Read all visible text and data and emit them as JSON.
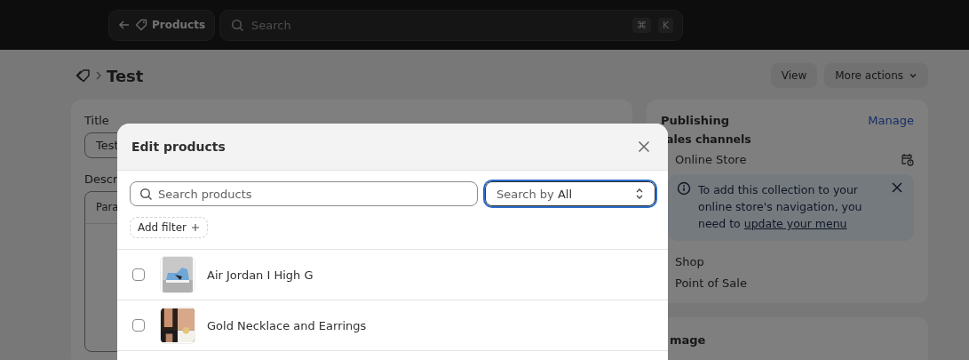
{
  "topbar": {
    "back_label": "Products",
    "search": {
      "placeholder": "Search",
      "shortcut": [
        "⌘",
        "K"
      ]
    }
  },
  "page": {
    "title": "Test",
    "actions": [
      "View",
      "More actions"
    ]
  },
  "main_card": {
    "title_label": "Title",
    "title_value": "Test",
    "description_label": "Descr",
    "editor_toolbar": "Para"
  },
  "publishing": {
    "title": "Publishing",
    "manage": "Manage",
    "channels_heading": "ales channels",
    "channels": [
      {
        "name": "Online Store",
        "scheduled": true
      },
      {
        "name": "Shop",
        "scheduled": false
      },
      {
        "name": "Point of Sale",
        "scheduled": false
      }
    ],
    "banner": {
      "text": "To add this collection to your online store's navigation, you need to ",
      "link": "update your menu"
    }
  },
  "next_card": {
    "title": "mage"
  },
  "modal": {
    "title": "Edit products",
    "search": {
      "placeholder": "Search products"
    },
    "search_by": {
      "label": "Search by",
      "value": "All",
      "focused": true
    },
    "add_filter": "Add filter",
    "products": [
      {
        "name": "Air Jordan I High G",
        "checked": false
      },
      {
        "name": "Gold Necklace and Earrings",
        "checked": false
      }
    ]
  }
}
